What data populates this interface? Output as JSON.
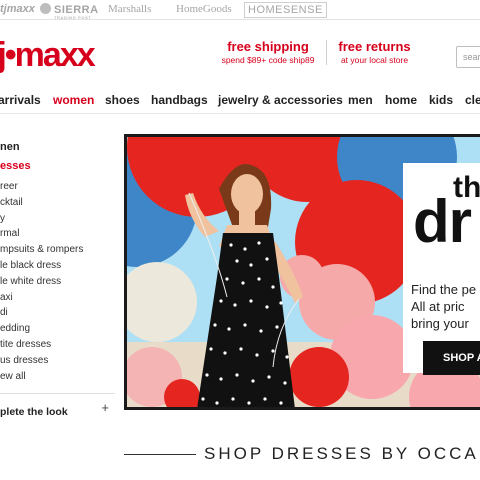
{
  "brands": {
    "tjmaxx": "tjmaxx",
    "sierra": "SIERRA",
    "sierra_sub": "TRADING POST",
    "marshalls": "Marshalls",
    "homegoods": "HomeGoods",
    "homesense": "HOMESENSE"
  },
  "header": {
    "logo": "tj•maxx",
    "promo_shipping": {
      "title": "free shipping",
      "detail": "spend $89+ code ship89"
    },
    "promo_returns": {
      "title": "free returns",
      "detail": "at your local store"
    },
    "search_placeholder": "search"
  },
  "nav": {
    "items": [
      {
        "label": "arrivals",
        "active": false
      },
      {
        "label": "women",
        "active": true
      },
      {
        "label": "shoes",
        "active": false
      },
      {
        "label": "handbags",
        "active": false
      },
      {
        "label": "jewelry & accessories",
        "active": false
      },
      {
        "label": "men",
        "active": false
      },
      {
        "label": "home",
        "active": false
      },
      {
        "label": "kids",
        "active": false
      },
      {
        "label": "cle",
        "active": false
      }
    ]
  },
  "sidebar": {
    "heading": "nen",
    "active": "esses",
    "items": [
      "reer",
      "cktail",
      "y",
      "rmal",
      "mpsuits & rompers",
      "le black dress",
      "le white dress",
      "axi",
      "di",
      "edding",
      "tite dresses",
      "us dresses",
      "ew all"
    ],
    "complete_look": "plete the look",
    "complete_look_icon": "+"
  },
  "hero": {
    "title_line1": "the",
    "title_line2": "dr",
    "copy": [
      "Find the pe",
      "All at pric",
      "bring your"
    ],
    "button": "SHOP A"
  },
  "section": {
    "title": "SHOP DRESSES BY OCCA"
  },
  "colors": {
    "brand_red": "#d6001c",
    "text_dark": "#222222",
    "sky_blue": "#aee0f5"
  }
}
